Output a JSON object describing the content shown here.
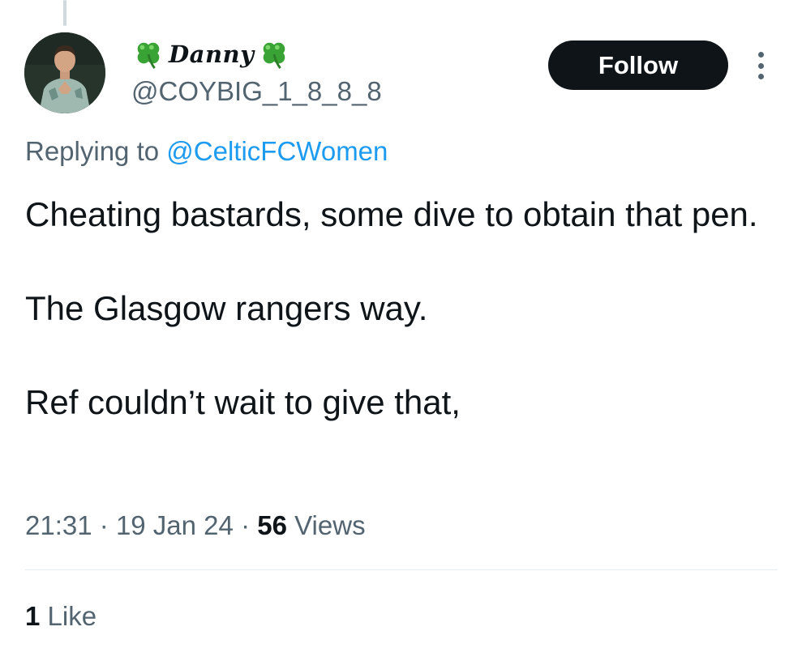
{
  "tweet": {
    "author": {
      "display_name": "Danny",
      "name_emoji_left": "shamrock",
      "name_emoji_right": "shamrock",
      "handle": "@COYBIG_1_8_8_8"
    },
    "follow_label": "Follow",
    "more_icon": "more-options-icon",
    "replying_prefix": "Replying to",
    "replying_to": "@CelticFCWomen",
    "text_paragraphs": [
      "Cheating bastards, some dive to obtain that pen.",
      "The Glasgow rangers way.",
      "Ref couldn’t wait to give that,"
    ],
    "time": "21:31",
    "separator": "·",
    "date": "19 Jan 24",
    "views_count": "56",
    "views_label": "Views",
    "likes_count": "1",
    "likes_label": "Like"
  },
  "colors": {
    "text_primary": "#0f1419",
    "text_secondary": "#536471",
    "link": "#1d9bf0",
    "follow_bg": "#0f1419",
    "divider": "#e6ecf0",
    "shamrock": "#3aa335"
  }
}
